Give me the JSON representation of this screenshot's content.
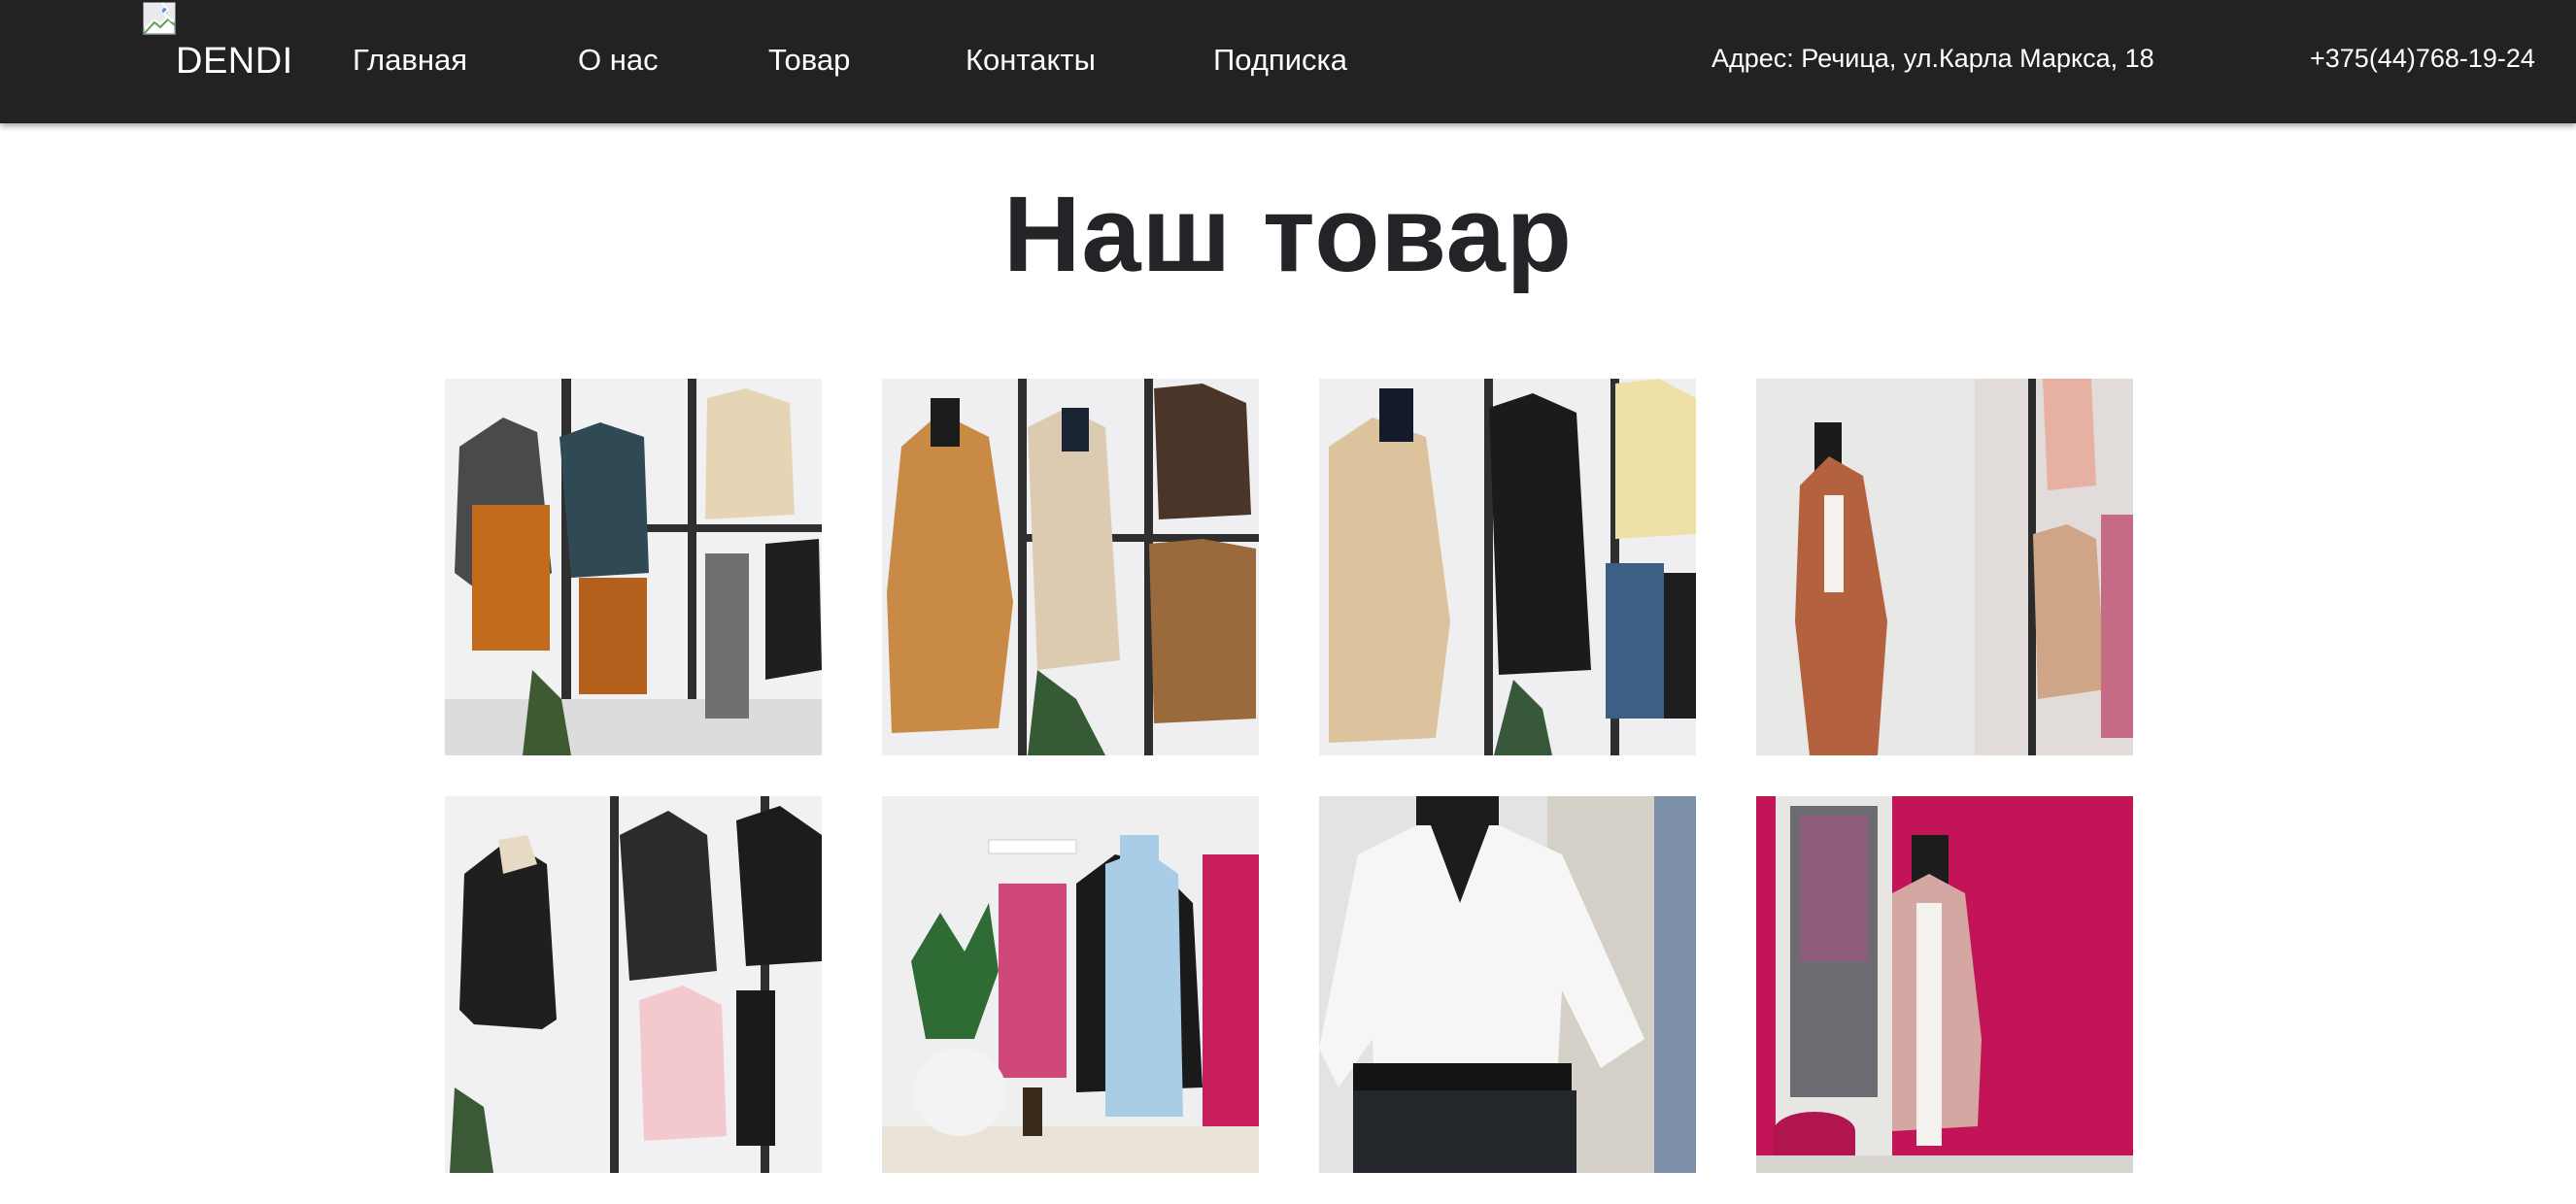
{
  "header": {
    "logo_text": "DENDI",
    "logo_image_icon": "broken-image-icon",
    "nav": [
      {
        "label": "Главная"
      },
      {
        "label": "О нас"
      },
      {
        "label": "Товар"
      },
      {
        "label": "Контакты"
      },
      {
        "label": "Подписка"
      }
    ],
    "address": "Адрес: Речица, ул.Карла Маркса, 18",
    "phone": "+375(44)768-19-24"
  },
  "main": {
    "title": "Наш товар",
    "products": [
      {
        "image": "product-photo-1"
      },
      {
        "image": "product-photo-2"
      },
      {
        "image": "product-photo-3"
      },
      {
        "image": "product-photo-4"
      },
      {
        "image": "product-photo-5"
      },
      {
        "image": "product-photo-6"
      },
      {
        "image": "product-photo-7"
      },
      {
        "image": "product-photo-8"
      }
    ]
  },
  "colors": {
    "header_bg": "#222222",
    "header_text": "#ffffff",
    "title_text": "#222428",
    "page_bg": "#ffffff"
  }
}
